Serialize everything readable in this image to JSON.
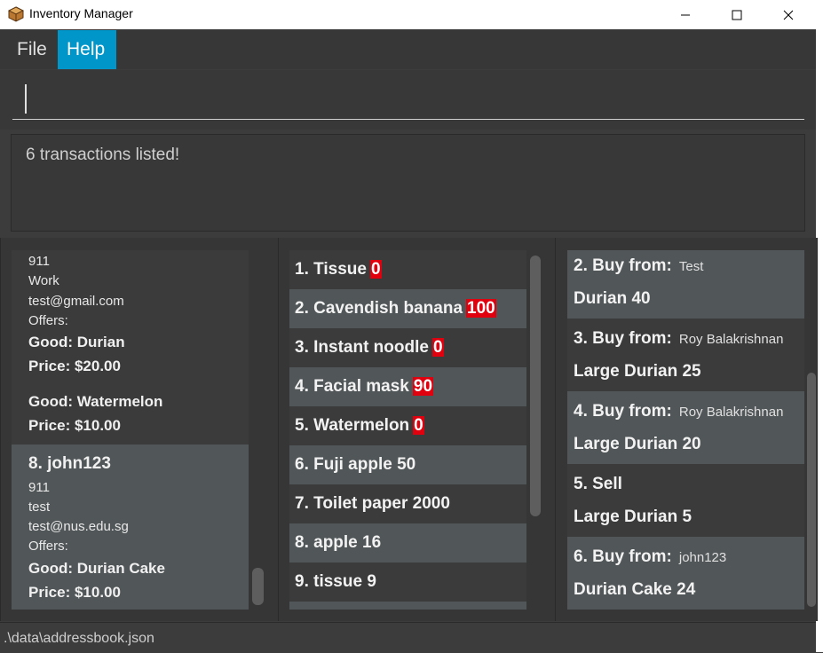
{
  "window": {
    "title": "Inventory Manager"
  },
  "menu": {
    "file": "File",
    "help": "Help"
  },
  "command": {
    "value": ""
  },
  "result": {
    "message": "6 transactions listed!"
  },
  "persons": {
    "card7": {
      "phone": "911",
      "address": "Work",
      "email": "test@gmail.com",
      "offers_label": "Offers:",
      "offers": [
        {
          "good": "Good: Durian",
          "price": "Price: $20.00"
        },
        {
          "good": "Good: Watermelon",
          "price": "Price: $10.00"
        }
      ]
    },
    "card8": {
      "header": "8.  john123",
      "phone": "911",
      "address": "test",
      "email": "test@nus.edu.sg",
      "offers_label": "Offers:",
      "offers": [
        {
          "good": "Good: Durian Cake",
          "price": "Price: $10.00"
        }
      ]
    }
  },
  "goods": [
    {
      "label": "1.  Tissue",
      "qty": "0",
      "low": true
    },
    {
      "label": "2.  Cavendish banana",
      "qty": "100",
      "low": true
    },
    {
      "label": "3.  Instant noodle",
      "qty": "0",
      "low": true
    },
    {
      "label": "4.  Facial mask",
      "qty": "90",
      "low": true
    },
    {
      "label": "5.  Watermelon",
      "qty": "0",
      "low": true
    },
    {
      "label": "6.  Fuji apple 50"
    },
    {
      "label": "7.  Toilet paper 2000"
    },
    {
      "label": "8.  apple 16"
    },
    {
      "label": "9.  tissue 9"
    }
  ],
  "transactions": [
    {
      "head": "2.  Buy from:",
      "name": "Test",
      "detail": "Durian 40"
    },
    {
      "head": "3.  Buy from:",
      "name": "Roy Balakrishnan",
      "detail": "Large Durian 25"
    },
    {
      "head": "4.  Buy from:",
      "name": "Roy Balakrishnan",
      "detail": "Large Durian 20"
    },
    {
      "head": "5.  Sell",
      "name": "",
      "detail": "Large Durian 5"
    },
    {
      "head": "6.  Buy from:",
      "name": "john123",
      "detail": "Durian Cake 24"
    }
  ],
  "status": {
    "path": ".\\data\\addressbook.json"
  }
}
